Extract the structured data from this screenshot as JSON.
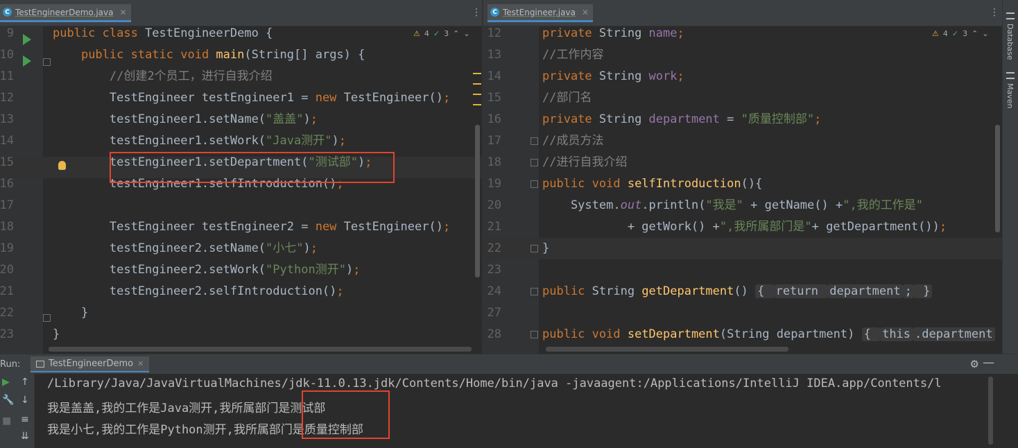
{
  "tabs": {
    "left": {
      "label": "TestEngineerDemo.java",
      "icon": "C"
    },
    "right": {
      "label": "TestEngineer.java",
      "icon": "C"
    }
  },
  "inspections": {
    "left": {
      "warnings": "4",
      "weak": "3"
    },
    "right": {
      "warnings": "4",
      "weak": "3"
    }
  },
  "left_editor": {
    "lines": [
      {
        "n": "9",
        "code": [
          [
            "kw",
            "public class "
          ],
          [
            "",
            "TestEngineerDemo {"
          ]
        ]
      },
      {
        "n": "10",
        "code": [
          [
            "",
            "    "
          ],
          [
            "kw",
            "public static void "
          ],
          [
            "fn",
            "main"
          ],
          [
            "",
            "(String[] args) {"
          ]
        ]
      },
      {
        "n": "11",
        "code": [
          [
            "",
            "        "
          ],
          [
            "cm",
            "//创建2个员工，进行自我介绍"
          ]
        ]
      },
      {
        "n": "12",
        "code": [
          [
            "",
            "        TestEngineer testEngineer1 = "
          ],
          [
            "kw",
            "new "
          ],
          [
            "",
            "TestEngineer()"
          ],
          [
            "kw",
            ";"
          ]
        ]
      },
      {
        "n": "13",
        "code": [
          [
            "",
            "        testEngineer1.setName("
          ],
          [
            "str",
            "\"盖盖\""
          ],
          [
            "",
            ")"
          ],
          [
            "kw",
            ";"
          ]
        ]
      },
      {
        "n": "14",
        "code": [
          [
            "",
            "        testEngineer1.setWork("
          ],
          [
            "str",
            "\"Java测开\""
          ],
          [
            "",
            ")"
          ],
          [
            "kw",
            ";"
          ]
        ]
      },
      {
        "n": "15",
        "code": [
          [
            "",
            "        testEngineer1.setDepartment("
          ],
          [
            "str",
            "\"测试部\""
          ],
          [
            "",
            ")"
          ],
          [
            "kw",
            ";"
          ]
        ]
      },
      {
        "n": "16",
        "code": [
          [
            "",
            "        testEngineer1.selfIntroduction()"
          ],
          [
            "kw",
            ";"
          ]
        ]
      },
      {
        "n": "17",
        "code": []
      },
      {
        "n": "18",
        "code": [
          [
            "",
            "        TestEngineer testEngineer2 = "
          ],
          [
            "kw",
            "new "
          ],
          [
            "",
            "TestEngineer()"
          ],
          [
            "kw",
            ";"
          ]
        ]
      },
      {
        "n": "19",
        "code": [
          [
            "",
            "        testEngineer2.setName("
          ],
          [
            "str",
            "\"小七\""
          ],
          [
            "",
            ")"
          ],
          [
            "kw",
            ";"
          ]
        ]
      },
      {
        "n": "20",
        "code": [
          [
            "",
            "        testEngineer2.setWork("
          ],
          [
            "str",
            "\"Python测开\""
          ],
          [
            "",
            ")"
          ],
          [
            "kw",
            ";"
          ]
        ]
      },
      {
        "n": "21",
        "code": [
          [
            "",
            "        testEngineer2.selfIntroduction()"
          ],
          [
            "kw",
            ";"
          ]
        ]
      },
      {
        "n": "22",
        "code": [
          [
            "",
            "    }"
          ]
        ]
      },
      {
        "n": "23",
        "code": [
          [
            "",
            "}"
          ]
        ]
      }
    ]
  },
  "right_editor": {
    "lines": [
      {
        "n": "12",
        "code": [
          [
            "kw",
            "private "
          ],
          [
            "",
            "String "
          ],
          [
            "fld",
            "name"
          ],
          [
            "kw",
            ";"
          ]
        ]
      },
      {
        "n": "13",
        "code": [
          [
            "cm",
            "//工作内容"
          ]
        ]
      },
      {
        "n": "14",
        "code": [
          [
            "kw",
            "private "
          ],
          [
            "",
            "String "
          ],
          [
            "fld",
            "work"
          ],
          [
            "kw",
            ";"
          ]
        ]
      },
      {
        "n": "15",
        "code": [
          [
            "cm",
            "//部门名"
          ]
        ]
      },
      {
        "n": "16",
        "code": [
          [
            "kw",
            "private "
          ],
          [
            "",
            "String "
          ],
          [
            "fld",
            "department"
          ],
          [
            "",
            " = "
          ],
          [
            "str",
            "\"质量控制部\""
          ],
          [
            "kw",
            ";"
          ]
        ]
      },
      {
        "n": "17",
        "code": [
          [
            "cm",
            "//成员方法"
          ]
        ]
      },
      {
        "n": "18",
        "code": [
          [
            "cm",
            "//进行自我介绍"
          ]
        ]
      },
      {
        "n": "19",
        "code": [
          [
            "kw",
            "public void "
          ],
          [
            "fn",
            "selfIntroduction"
          ],
          [
            "",
            "(){"
          ]
        ]
      },
      {
        "n": "20",
        "code": [
          [
            "",
            "    System."
          ],
          [
            "it",
            "out"
          ],
          [
            "",
            ".println("
          ],
          [
            "str",
            "\"我是\""
          ],
          [
            "",
            " + getName() +"
          ],
          [
            "str",
            "\",我的工作是\""
          ]
        ]
      },
      {
        "n": "21",
        "code": [
          [
            "",
            "            + getWork() +"
          ],
          [
            "str",
            "\",我所属部门是\""
          ],
          [
            "",
            "+ getDepartment())"
          ],
          [
            "kw",
            ";"
          ]
        ]
      },
      {
        "n": "22",
        "code": [
          [
            "",
            "}"
          ]
        ]
      },
      {
        "n": "23",
        "code": []
      },
      {
        "n": "24",
        "code": [
          [
            "kw",
            "public "
          ],
          [
            "",
            "String "
          ],
          [
            "fn",
            "getDepartment"
          ],
          [
            "",
            "() "
          ],
          [
            "fold",
            "{ "
          ],
          [
            "foldkw",
            "return "
          ],
          [
            "foldfld",
            "department"
          ],
          [
            "foldkw",
            ";"
          ],
          [
            "fold",
            " }"
          ]
        ]
      },
      {
        "n": "27",
        "code": []
      },
      {
        "n": "28",
        "code": [
          [
            "kw",
            "public void "
          ],
          [
            "fn",
            "setDepartment"
          ],
          [
            "",
            "(String department) "
          ],
          [
            "fold",
            "{ "
          ],
          [
            "foldkw",
            "this"
          ],
          [
            "foldfld",
            ".department"
          ]
        ]
      }
    ]
  },
  "run_panel": {
    "label": "Run:",
    "tab_label": "TestEngineerDemo",
    "output": [
      "/Library/Java/JavaVirtualMachines/jdk-11.0.13.jdk/Contents/Home/bin/java -javaagent:/Applications/IntelliJ IDEA.app/Contents/l",
      "我是盖盖,我的工作是Java测开,我所属部门是测试部",
      "我是小七,我的工作是Python测开,我所属部门是质量控制部"
    ]
  },
  "sidebar": {
    "database": "Database",
    "maven": "Maven"
  },
  "colors": {
    "keyword": "#cc7832",
    "string": "#6a8759",
    "comment": "#808080",
    "method": "#ffc66d",
    "field": "#9876aa",
    "annotation_box": "#e2442f"
  }
}
